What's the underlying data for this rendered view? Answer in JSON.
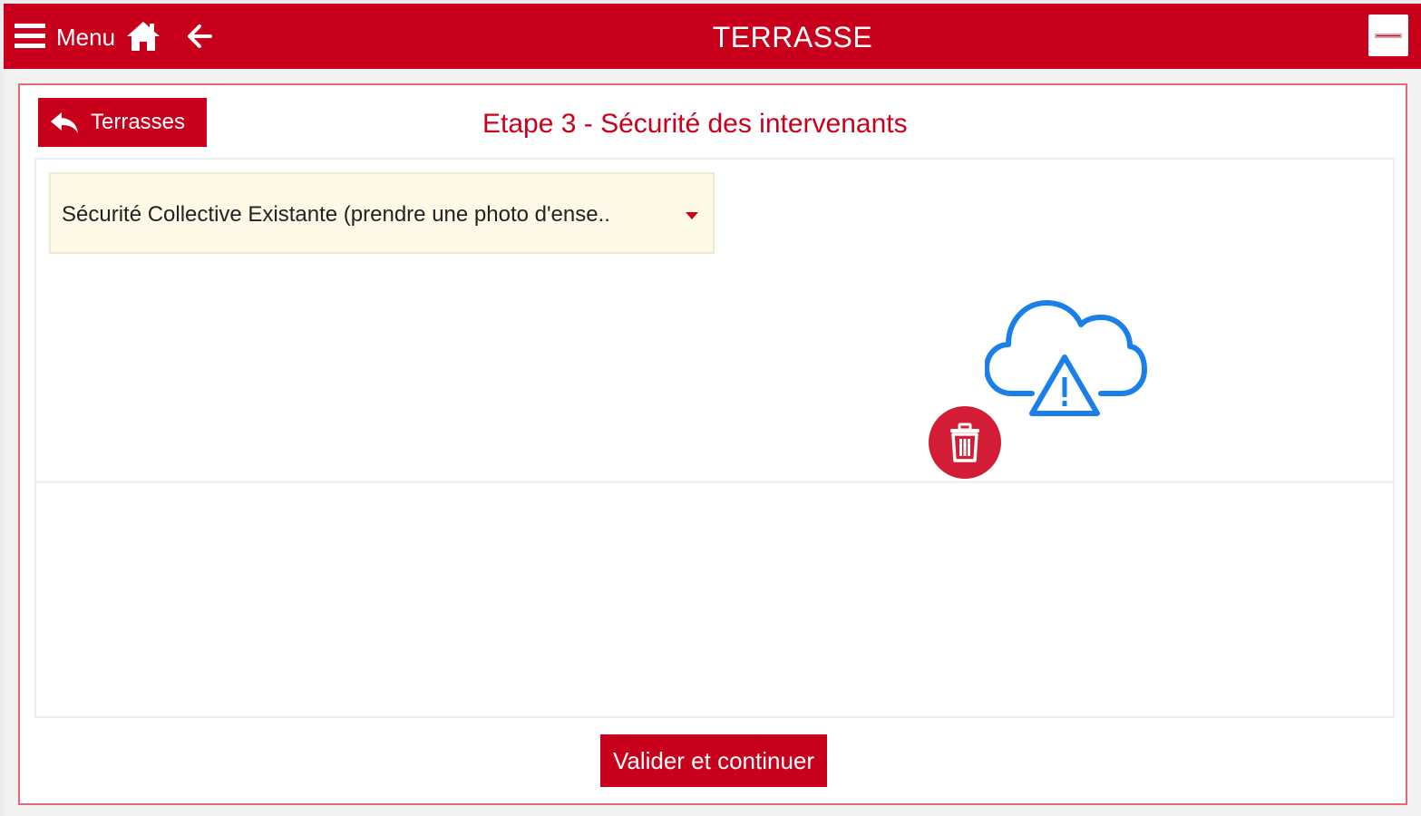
{
  "topbar": {
    "menu_label": "Menu",
    "title": "TERRASSE",
    "menu_icon": "hamburger-icon",
    "home_icon": "home-icon",
    "back_icon": "arrow-left-icon",
    "logo_icon": "company-logo"
  },
  "header": {
    "back_button_label": "Terrasses",
    "back_button_icon": "undo-arrow-icon",
    "step_title": "Etape 3 - Sécurité des intervenants"
  },
  "form": {
    "dropdown_value": "Sécurité Collective Existante (prendre une photo d'ense..",
    "dropdown_icon": "caret-down-icon",
    "image_status_icon": "cloud-warning-icon",
    "delete_icon": "trash-icon"
  },
  "footer": {
    "submit_label": "Valider et continuer"
  },
  "colors": {
    "brand_red": "#c8001c",
    "delete_red": "#d31c36",
    "cloud_blue": "#1a7fe8",
    "dropdown_bg": "#fdf9e6"
  }
}
